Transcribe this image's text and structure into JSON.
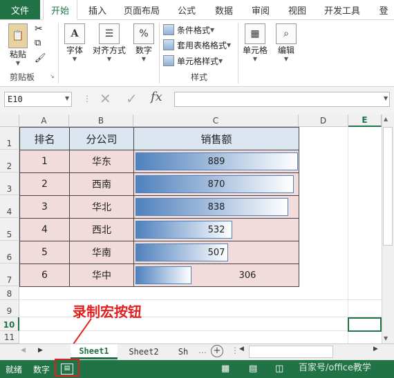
{
  "ribbon_tabs": [
    "文件",
    "开始",
    "插入",
    "页面布局",
    "公式",
    "数据",
    "审阅",
    "视图",
    "开发工具",
    "登"
  ],
  "ribbon": {
    "paste": "粘贴",
    "clipboard": "剪贴板",
    "font": "字体",
    "align": "对齐方式",
    "number": "数字",
    "cond_format": "条件格式",
    "table_format": "套用表格格式",
    "cell_style": "单元格样式",
    "styles": "样式",
    "cells": "单元格",
    "edit": "编辑",
    "font_icon": "A",
    "number_icon": "%"
  },
  "formula_bar": {
    "name_box": "E10",
    "fx": "fx"
  },
  "columns": [
    "A",
    "B",
    "C",
    "D",
    "E"
  ],
  "rows": [
    "1",
    "2",
    "3",
    "4",
    "5",
    "6",
    "7",
    "8",
    "9",
    "10",
    "11"
  ],
  "table": {
    "headers": [
      "排名",
      "分公司",
      "销售额"
    ],
    "rows": [
      {
        "rank": "1",
        "branch": "华东",
        "sales": "889"
      },
      {
        "rank": "2",
        "branch": "西南",
        "sales": "870"
      },
      {
        "rank": "3",
        "branch": "华北",
        "sales": "838"
      },
      {
        "rank": "4",
        "branch": "西北",
        "sales": "532"
      },
      {
        "rank": "5",
        "branch": "华南",
        "sales": "507"
      },
      {
        "rank": "6",
        "branch": "华中",
        "sales": "306"
      }
    ],
    "bar_fraction": [
      0.996,
      0.97,
      0.935,
      0.595,
      0.566,
      0.342
    ],
    "bar_color": "#4f81bd",
    "header_fill": "#dce6f1",
    "data_fill": "#f2dcdb"
  },
  "sheets": [
    "Sheet1",
    "Sheet2",
    "Sh"
  ],
  "status": {
    "ready": "就绪",
    "num": "数字"
  },
  "annotation": "录制宏按钮",
  "watermark": "百家号/office教学",
  "accent": "#217346"
}
